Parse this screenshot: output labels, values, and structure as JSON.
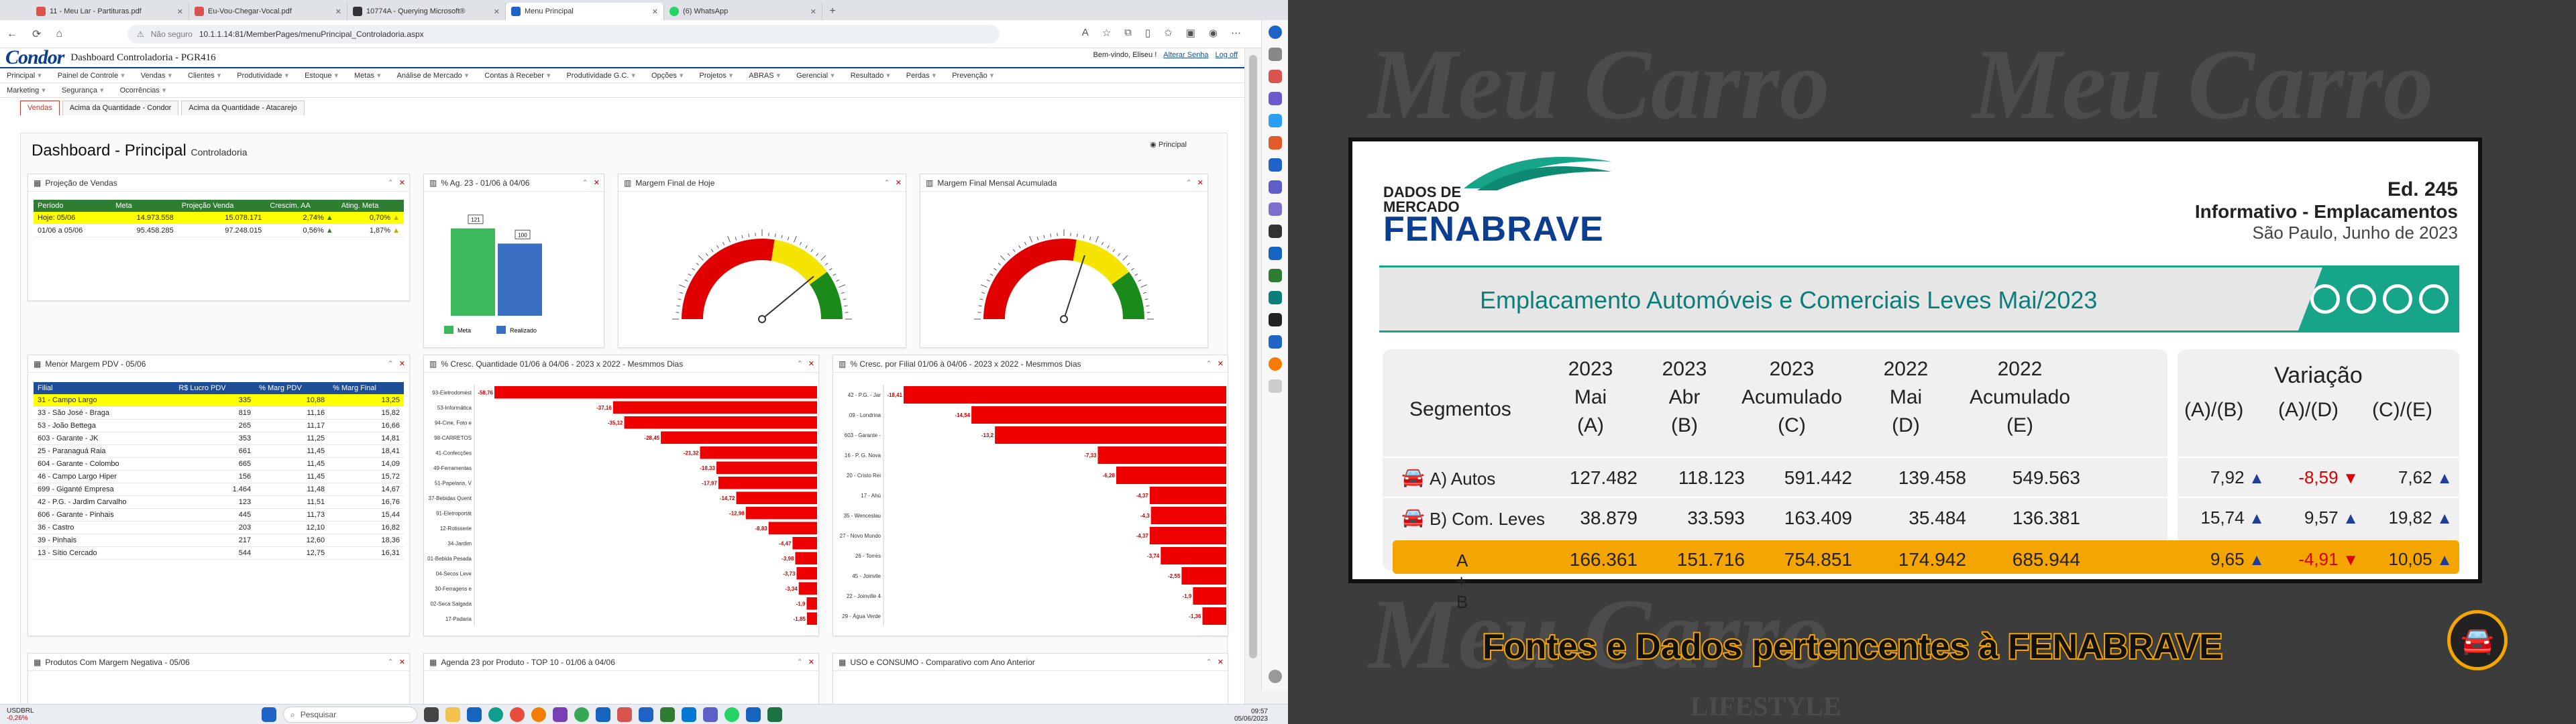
{
  "browser": {
    "tabs": [
      {
        "label": "11 - Meu Lar - Partituras.pdf",
        "color": "#d9534f"
      },
      {
        "label": "Eu-Vou-Chegar-Vocal.pdf",
        "color": "#d9534f"
      },
      {
        "label": "10774A - Querying Microsoft®",
        "color": "#333333"
      },
      {
        "label": "Menu Principal",
        "color": "#1f63c6"
      },
      {
        "label": "(6) WhatsApp",
        "color": "#25d366"
      }
    ],
    "not_secure": "Não seguro",
    "url": "10.1.1.14:81/MemberPages/menuPrincipal_Controladoria.aspx"
  },
  "app": {
    "logo": "Condor",
    "title": "Dashboard Controladoria - PGR416",
    "welcome": "Bem-vindo, Eliseu !",
    "change_password": "Alterar Senha",
    "logoff": "Log off",
    "menu_row1": [
      "Principal",
      "Painel de Controle",
      "Vendas",
      "Clientes",
      "Produtividade",
      "Estoque",
      "Metas",
      "Análise de Mercado",
      "Contas à Receber",
      "Produtividade G.C.",
      "Opções",
      "Projetos",
      "ABRAS",
      "Gerencial",
      "Resultado",
      "Perdas",
      "Prevenção"
    ],
    "menu_row2": [
      "Marketing",
      "Segurança",
      "Ocorrências"
    ],
    "subtabs": [
      "Vendas",
      "Acima da Quantidade - Condor",
      "Acima da Quantidade - Atacarejo"
    ],
    "page_title": "Dashboard - Principal",
    "page_subtitle": "Controladoria",
    "principal_link": "Principal"
  },
  "projecao": {
    "title": "Projeção de Vendas",
    "headers": [
      "Período",
      "Meta",
      "Projeção Venda",
      "Crescim. AA",
      "Ating. Meta"
    ],
    "rows": [
      {
        "periodo": "Hoje: 05/06",
        "meta": "14.973.558",
        "projecao": "15.078.171",
        "cresc": "2,74%",
        "ating": "0,70%"
      },
      {
        "periodo": "01/06 a 05/06",
        "meta": "95.458.285",
        "projecao": "97.248.015",
        "cresc": "0,56%",
        "ating": "1,87%"
      }
    ]
  },
  "ag23": {
    "title": "% Ag. 23 - 01/06 à 04/06",
    "bars": [
      {
        "name": "Meta",
        "value": 121,
        "color": "#3cb95a"
      },
      {
        "name": "Realizado",
        "value": 100,
        "color": "#3a6fc4"
      }
    ],
    "labels": [
      "121",
      "100"
    ]
  },
  "margem_hoje": {
    "title": "Margem Final de Hoje",
    "needle_pct": 0.78
  },
  "margem_mensal": {
    "title": "Margem Final Mensal Acumulada",
    "needle_pct": 0.6
  },
  "menor_margem": {
    "title": "Menor Margem PDV - 05/06",
    "headers": [
      "Filial",
      "R$ Lucro PDV",
      "% Marg PDV",
      "% Marg Final"
    ],
    "rows": [
      [
        "31 - Campo Largo",
        "335",
        "10,88",
        "13,25"
      ],
      [
        "33 - São José - Braga",
        "819",
        "11,16",
        "15,82"
      ],
      [
        "53 - João Bettega",
        "265",
        "11,17",
        "16,66"
      ],
      [
        "603 - Garante - JK",
        "353",
        "11,25",
        "14,81"
      ],
      [
        "25 - Paranaguá Raia",
        "661",
        "11,45",
        "18,41"
      ],
      [
        "604 - Garante - Colombo",
        "665",
        "11,45",
        "14,09"
      ],
      [
        "46 - Campo Largo Hiper",
        "156",
        "11,45",
        "15,72"
      ],
      [
        "699 - Giganté Empresa",
        "1.464",
        "11,48",
        "14,67"
      ],
      [
        "42 - P.G. - Jardim Carvalho",
        "123",
        "11,51",
        "16,76"
      ],
      [
        "606 - Garante - Pinhais",
        "445",
        "11,73",
        "15,44"
      ],
      [
        "36 - Castro",
        "203",
        "12,10",
        "16,82"
      ],
      [
        "39 - Pinhais",
        "217",
        "12,60",
        "18,36"
      ],
      [
        "13 - Sítio Cercado",
        "544",
        "12,75",
        "16,31"
      ]
    ]
  },
  "cresc_qtd": {
    "title": "% Cresc. Quantidade 01/06 à 04/06 - 2023 x 2022 - Mesmmos Dias",
    "items": [
      {
        "label": "93-Eletrodomést",
        "value": "-58,76"
      },
      {
        "label": "53-Informática",
        "value": "-37,16"
      },
      {
        "label": "94-Cine, Foto e",
        "value": "-35,12"
      },
      {
        "label": "98-CARRETOS",
        "value": "-28,45"
      },
      {
        "label": "41-Confecções",
        "value": "-21,32"
      },
      {
        "label": "49-Ferramentas",
        "value": "-18,33"
      },
      {
        "label": "51-Papelaria, V",
        "value": "-17,97"
      },
      {
        "label": "37-Bebidas Quent",
        "value": "-14,72"
      },
      {
        "label": "91-Eletroportát",
        "value": "-12,98"
      },
      {
        "label": "12-Rotisserie",
        "value": "-8,83"
      },
      {
        "label": "34-Jardim",
        "value": "-4,47"
      },
      {
        "label": "01-Bebida Pesada",
        "value": "-3,98"
      },
      {
        "label": "04-Secos Leve",
        "value": "-3,73"
      },
      {
        "label": "30-Ferragens e",
        "value": "-3,34"
      },
      {
        "label": "02-Seca Salgada",
        "value": "-1,9"
      },
      {
        "label": "17-Padaria",
        "value": "-1,85"
      }
    ]
  },
  "cresc_filial": {
    "title": "% Cresc. por Filial 01/06 à 04/06 - 2023 x 2022 - Mesmmos Dias",
    "items": [
      {
        "label": "42 - P.G. - Jar",
        "value": "-18,41"
      },
      {
        "label": "09 - Londrina",
        "value": "-14,54"
      },
      {
        "label": "603 - Garante -",
        "value": "-13,2"
      },
      {
        "label": "16 - P. G. Nova",
        "value": "-7,33"
      },
      {
        "label": "20 - Cristo Rei",
        "value": "-6,28"
      },
      {
        "label": "17 - Ahú",
        "value": "-4,37"
      },
      {
        "label": "35 - Wenceslau",
        "value": "-4,3"
      },
      {
        "label": "27 - Novo Mundo",
        "value": "-4,37"
      },
      {
        "label": "26 - Torres",
        "value": "-3,74"
      },
      {
        "label": "45 - Joinvile",
        "value": "-2,55"
      },
      {
        "label": "22 - Joinville 4",
        "value": "-1,9"
      },
      {
        "label": "29 - Água Verde",
        "value": "-1,36"
      }
    ]
  },
  "bottom_panels": [
    "Produtos Com Margem Negativa - 05/06",
    "Agenda 23 por Produto - TOP 10 - 01/06 à 04/06",
    "USO e CONSUMO - Comparativo com Ano Anterior"
  ],
  "taskbar": {
    "ticker": "USDBRL",
    "ticker_change": "-0,26%",
    "search": "Pesquisar",
    "time": "09:57",
    "date": "05/06/2023"
  },
  "fenabrave": {
    "dados_de": "DADOS DE",
    "mercado": "MERCADO",
    "name": "FENABRAVE",
    "edition": "Ed. 245",
    "informativo": "Informativo - Emplacamentos",
    "location": "São Paulo, Junho de 2023",
    "banner": "Emplacamento Automóveis e Comerciais Leves Mai/2023",
    "segmentos": "Segmentos",
    "columns": [
      {
        "l1": "2023",
        "l2": "Mai",
        "l3": "(A)"
      },
      {
        "l1": "2023",
        "l2": "Abr",
        "l3": "(B)"
      },
      {
        "l1": "2023",
        "l2": "Acumulado",
        "l3": "(C)"
      },
      {
        "l1": "2022",
        "l2": "Mai",
        "l3": "(D)"
      },
      {
        "l1": "2022",
        "l2": "Acumulado",
        "l3": "(E)"
      }
    ],
    "variacao": "Variação",
    "var_cols": [
      "(A)/(B)",
      "(A)/(D)",
      "(C)/(E)"
    ],
    "rows": [
      {
        "seg": "A) Autos",
        "vals": [
          "127.482",
          "118.123",
          "591.442",
          "139.458",
          "549.563"
        ],
        "var": [
          "7,92",
          "-8,59",
          "7,62"
        ],
        "dir": [
          "up",
          "down",
          "up"
        ]
      },
      {
        "seg": "B) Com. Leves",
        "vals": [
          "38.879",
          "33.593",
          "163.409",
          "35.484",
          "136.381"
        ],
        "var": [
          "15,74",
          "9,57",
          "19,82"
        ],
        "dir": [
          "up",
          "up",
          "up"
        ]
      },
      {
        "seg": "A + B",
        "vals": [
          "166.361",
          "151.716",
          "754.851",
          "174.942",
          "685.944"
        ],
        "var": [
          "9,65",
          "-4,91",
          "10,05"
        ],
        "dir": [
          "up",
          "down",
          "up"
        ]
      }
    ],
    "footer": "Fontes e Dados pertencentes à FENABRAVE",
    "watermark": "Meu Carro",
    "watermark_sub": "LIFESTYLE"
  }
}
